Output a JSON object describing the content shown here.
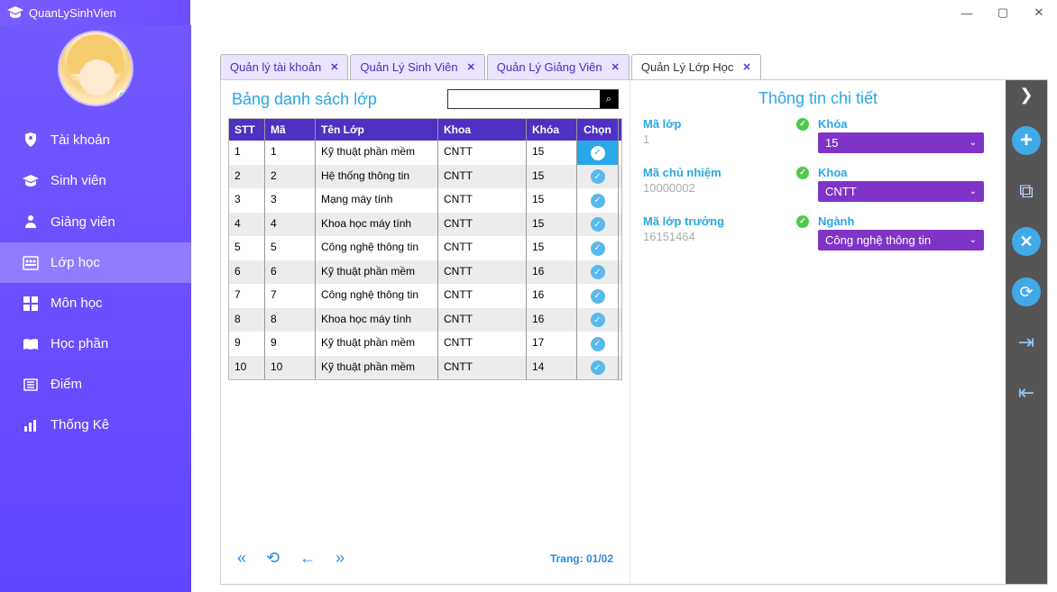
{
  "app": {
    "title": "QuanLySinhVien"
  },
  "sidebar": {
    "items": [
      {
        "label": "Tài khoản"
      },
      {
        "label": "Sinh viên"
      },
      {
        "label": "Giảng viên"
      },
      {
        "label": "Lớp học"
      },
      {
        "label": "Môn học"
      },
      {
        "label": "Học phần"
      },
      {
        "label": "Điểm"
      },
      {
        "label": "Thống Kê"
      }
    ]
  },
  "tabs": [
    {
      "label": "Quản lý tài khoản"
    },
    {
      "label": "Quản Lý Sinh Viên"
    },
    {
      "label": "Quản Lý Giảng Viên"
    },
    {
      "label": "Quản Lý Lớp Học"
    }
  ],
  "list": {
    "title": "Bảng danh sách lớp",
    "search_value": "",
    "columns": {
      "stt": "STT",
      "ma": "Mã",
      "ten": "Tên Lớp",
      "khoa": "Khoa",
      "khoa2": "Khóa",
      "chon": "Chọn"
    },
    "rows": [
      {
        "stt": "1",
        "ma": "1",
        "ten": "Kỹ thuật phần mềm",
        "khoa": "CNTT",
        "khoa2": "15",
        "sel": true
      },
      {
        "stt": "2",
        "ma": "2",
        "ten": "Hệ thống thông tin",
        "khoa": "CNTT",
        "khoa2": "15",
        "sel": false
      },
      {
        "stt": "3",
        "ma": "3",
        "ten": "Mạng máy tính",
        "khoa": "CNTT",
        "khoa2": "15",
        "sel": false
      },
      {
        "stt": "4",
        "ma": "4",
        "ten": "Khoa học máy tính",
        "khoa": "CNTT",
        "khoa2": "15",
        "sel": false
      },
      {
        "stt": "5",
        "ma": "5",
        "ten": "Công nghệ thông tin",
        "khoa": "CNTT",
        "khoa2": "15",
        "sel": false
      },
      {
        "stt": "6",
        "ma": "6",
        "ten": "Kỹ thuật phần mềm",
        "khoa": "CNTT",
        "khoa2": "16",
        "sel": false
      },
      {
        "stt": "7",
        "ma": "7",
        "ten": "Công nghệ thông tin",
        "khoa": "CNTT",
        "khoa2": "16",
        "sel": false
      },
      {
        "stt": "8",
        "ma": "8",
        "ten": "Khoa học máy tính",
        "khoa": "CNTT",
        "khoa2": "16",
        "sel": false
      },
      {
        "stt": "9",
        "ma": "9",
        "ten": "Kỹ thuật phần mềm",
        "khoa": "CNTT",
        "khoa2": "17",
        "sel": false
      },
      {
        "stt": "10",
        "ma": "10",
        "ten": "Kỹ thuật phần mềm",
        "khoa": "CNTT",
        "khoa2": "14",
        "sel": false
      }
    ],
    "pager": {
      "info": "Trang: 01/02"
    }
  },
  "detail": {
    "title": "Thông tin chi tiết",
    "labels": {
      "ma_lop": "Mã lớp",
      "khoa2": "Khóa",
      "ma_cn": "Mã chủ nhiệm",
      "khoa": "Khoa",
      "ma_lt": "Mã lớp trưởng",
      "nganh": "Ngành"
    },
    "values": {
      "ma_lop": "1",
      "khoa2": "15",
      "ma_cn": "10000002",
      "khoa": "CNTT",
      "ma_lt": "16151464",
      "nganh": "Công nghệ thông tin"
    }
  },
  "glyphs": {
    "min": "—",
    "max": "▢",
    "close": "✕",
    "tabx": "✕",
    "search": "⌕",
    "check": "✓",
    "dd": "⌄",
    "first": "«",
    "back": "⟲",
    "prev": "←",
    "next": "»",
    "expand": "❯",
    "add": "+",
    "copy": "⧉",
    "del": "✕",
    "ref": "⟳",
    "in": "⇥",
    "out": "⇤"
  }
}
